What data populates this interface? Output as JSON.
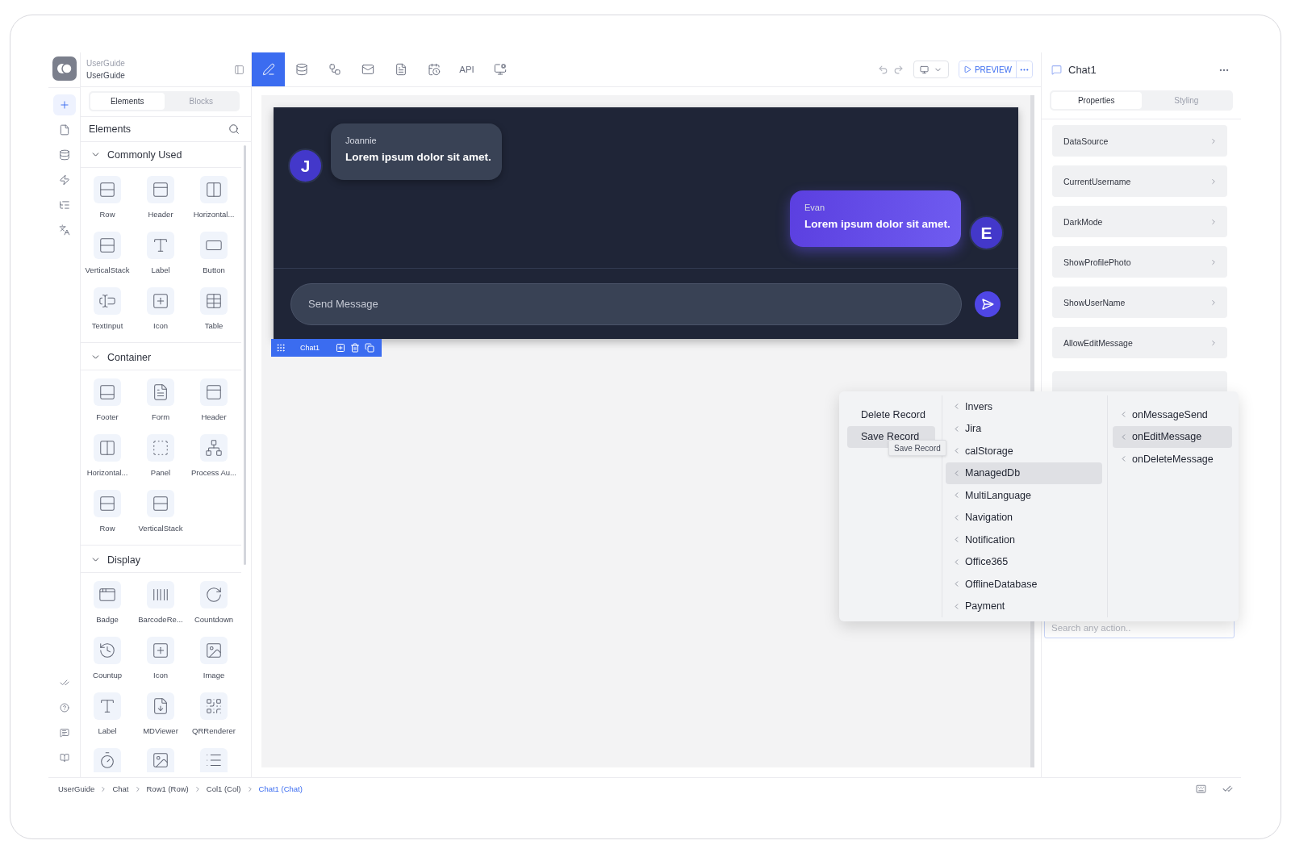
{
  "project": {
    "label": "UserGuide",
    "name": "UserGuide"
  },
  "rail": {
    "top": [
      {
        "selected": true
      },
      {
        "selected": false
      },
      {
        "selected": false
      },
      {
        "selected": false
      },
      {
        "selected": false
      },
      {
        "selected": false
      }
    ],
    "bottom": [
      {
        "selected": false
      },
      {
        "selected": false
      },
      {
        "selected": false
      },
      {
        "selected": false
      }
    ]
  },
  "left_panel": {
    "tabs": [
      {
        "label": "Elements",
        "selected": true
      },
      {
        "label": "Blocks",
        "selected": false
      }
    ],
    "title": "Elements",
    "sections": [
      {
        "title": "Commonly Used",
        "expanded": true,
        "items": [
          {
            "label": "Row"
          },
          {
            "label": "Header"
          },
          {
            "label": "Horizontal..."
          },
          {
            "label": "VerticalStack"
          },
          {
            "label": "Label"
          },
          {
            "label": "Button"
          },
          {
            "label": "TextInput"
          },
          {
            "label": "Icon"
          },
          {
            "label": "Table"
          }
        ]
      },
      {
        "title": "Container",
        "expanded": true,
        "items": [
          {
            "label": "Footer"
          },
          {
            "label": "Form"
          },
          {
            "label": "Header"
          },
          {
            "label": "Horizontal..."
          },
          {
            "label": "Panel"
          },
          {
            "label": "Process Au..."
          },
          {
            "label": "Row"
          },
          {
            "label": "VerticalStack"
          }
        ]
      },
      {
        "title": "Display",
        "expanded": true,
        "items": [
          {
            "label": "Badge"
          },
          {
            "label": "BarcodeRe..."
          },
          {
            "label": "Countdown"
          },
          {
            "label": "Countup"
          },
          {
            "label": "Icon"
          },
          {
            "label": "Image"
          },
          {
            "label": "Label"
          },
          {
            "label": "MDViewer"
          },
          {
            "label": "QRRenderer"
          },
          {
            "kind": "cut_off"
          },
          {
            "kind": "cut_off"
          },
          {
            "kind": "cut_off"
          }
        ]
      }
    ]
  },
  "toolbar": {
    "tools": [
      {
        "kind": "icon",
        "selected": true
      },
      {
        "kind": "icon",
        "selected": false
      },
      {
        "kind": "icon",
        "selected": false
      },
      {
        "kind": "icon",
        "selected": false
      },
      {
        "kind": "icon",
        "selected": false
      },
      {
        "kind": "icon",
        "selected": false
      },
      {
        "kind": "text",
        "label": "API",
        "selected": false
      },
      {
        "kind": "icon",
        "selected": false
      }
    ],
    "preview": "PREVIEW"
  },
  "canvas": {
    "chat": {
      "messages": [
        {
          "kind": "incoming",
          "sender": "Joannie",
          "text": "Lorem ipsum dolor sit amet.",
          "avatar": "J"
        },
        {
          "kind": "outgoing",
          "sender": "Evan",
          "text": "Lorem ipsum dolor sit amet.",
          "avatar": "E"
        }
      ],
      "placeholder": "Send Message"
    },
    "selection_label": "Chat1"
  },
  "right_panel": {
    "title": "Chat1",
    "tabs": [
      {
        "label": "Properties",
        "selected": true
      },
      {
        "label": "Styling",
        "selected": false
      }
    ],
    "properties": [
      "DataSource",
      "CurrentUsername",
      "DarkMode",
      "ShowProfilePhoto",
      "ShowUserName",
      "AllowEditMessage"
    ],
    "search": {
      "placeholder": "Search any action.."
    }
  },
  "action_menu": {
    "actions": [
      {
        "label": "Delete Record",
        "selected": false
      },
      {
        "label": "Save Record",
        "selected": true
      }
    ],
    "plugins": [
      {
        "label": "Invers",
        "selected": false
      },
      {
        "label": "Jira",
        "selected": false
      },
      {
        "label": "calStorage",
        "selected": false
      },
      {
        "label": "ManagedDb",
        "selected": true
      },
      {
        "label": "MultiLanguage",
        "selected": false
      },
      {
        "label": "Navigation",
        "selected": false
      },
      {
        "label": "Notification",
        "selected": false
      },
      {
        "label": "Office365",
        "selected": false
      },
      {
        "label": "OfflineDatabase",
        "selected": false
      },
      {
        "label": "Payment",
        "selected": false
      }
    ],
    "events": [
      {
        "label": "onMessageSend",
        "selected": false
      },
      {
        "label": "onEditMessage",
        "selected": true
      },
      {
        "label": "onDeleteMessage",
        "selected": false
      }
    ],
    "tooltip": "Save Record"
  },
  "breadcrumb": [
    {
      "label": "UserGuide",
      "selected": false
    },
    {
      "label": "Chat",
      "selected": false
    },
    {
      "label": "Row1 (Row)",
      "selected": false
    },
    {
      "label": "Col1 (Col)",
      "selected": false
    },
    {
      "label": "Chat1 (Chat)",
      "selected": true
    }
  ]
}
